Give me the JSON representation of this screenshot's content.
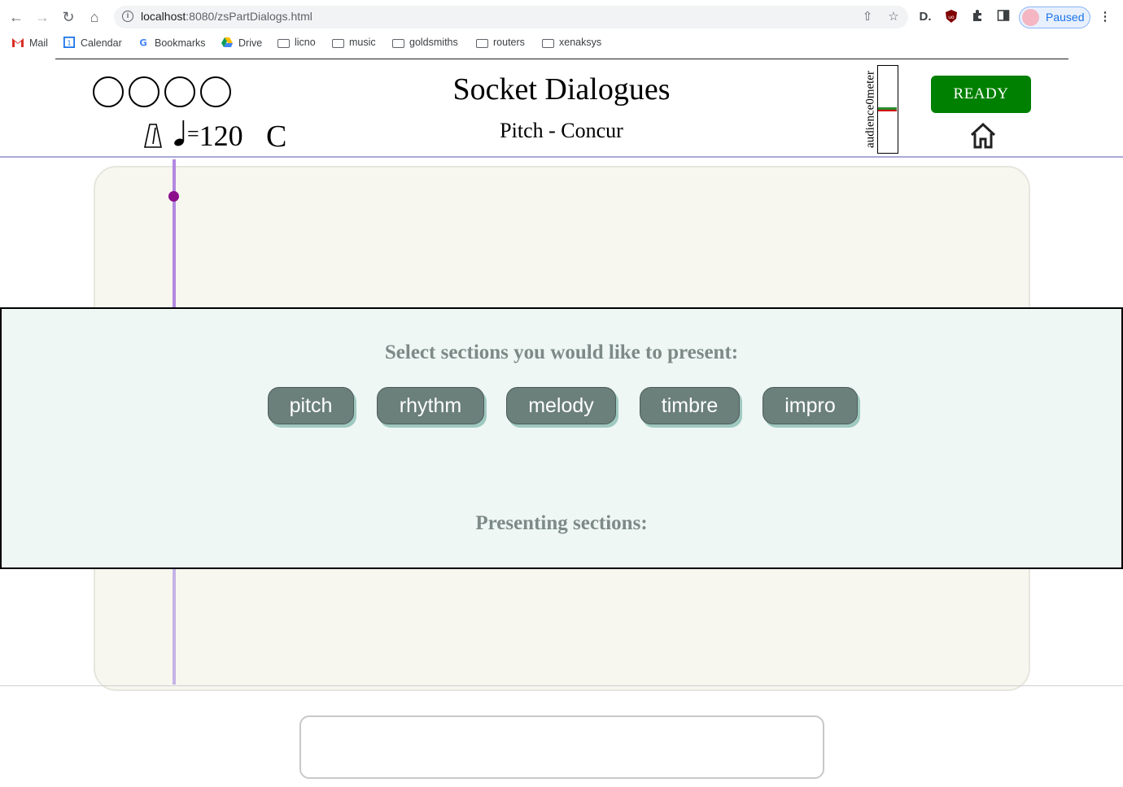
{
  "browser": {
    "url_host": "localhost",
    "url_rest": ":8080/zsPartDialogs.html",
    "profile_status": "Paused",
    "bookmarks": [
      {
        "label": "Mail",
        "icon": "gmail-icon"
      },
      {
        "label": "Calendar",
        "icon": "calendar-icon"
      },
      {
        "label": "Bookmarks",
        "icon": "google-icon"
      },
      {
        "label": "Drive",
        "icon": "drive-icon"
      },
      {
        "label": "licno",
        "icon": "folder-icon"
      },
      {
        "label": "music",
        "icon": "folder-icon"
      },
      {
        "label": "goldsmiths",
        "icon": "folder-icon"
      },
      {
        "label": "routers",
        "icon": "folder-icon"
      },
      {
        "label": "xenaksys",
        "icon": "folder-icon"
      }
    ]
  },
  "header": {
    "title": "Socket Dialogues",
    "subtitle": "Pitch - Concur",
    "tempo_eq": "=",
    "tempo_value": "120",
    "key": "C",
    "meter_label": "audience0meter",
    "meter_level": 0.5,
    "ready_label": "READY"
  },
  "dialog": {
    "heading": "Select sections you would like to present:",
    "sections": [
      "pitch",
      "rhythm",
      "melody",
      "timbre",
      "impro"
    ],
    "presenting_heading": "Presenting sections:"
  },
  "colors": {
    "ready": "#008000",
    "section_button": "#6b7f7b",
    "cursor": "#8b0e8b"
  }
}
